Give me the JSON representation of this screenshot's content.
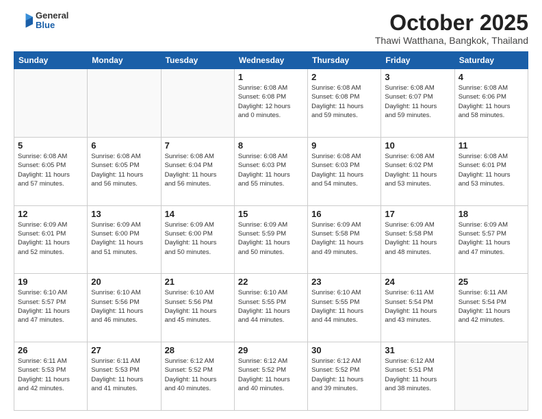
{
  "header": {
    "logo": {
      "general": "General",
      "blue": "Blue"
    },
    "title": "October 2025",
    "location": "Thawi Watthana, Bangkok, Thailand"
  },
  "weekdays": [
    "Sunday",
    "Monday",
    "Tuesday",
    "Wednesday",
    "Thursday",
    "Friday",
    "Saturday"
  ],
  "weeks": [
    [
      {
        "day": "",
        "info": ""
      },
      {
        "day": "",
        "info": ""
      },
      {
        "day": "",
        "info": ""
      },
      {
        "day": "1",
        "info": "Sunrise: 6:08 AM\nSunset: 6:08 PM\nDaylight: 12 hours\nand 0 minutes."
      },
      {
        "day": "2",
        "info": "Sunrise: 6:08 AM\nSunset: 6:08 PM\nDaylight: 11 hours\nand 59 minutes."
      },
      {
        "day": "3",
        "info": "Sunrise: 6:08 AM\nSunset: 6:07 PM\nDaylight: 11 hours\nand 59 minutes."
      },
      {
        "day": "4",
        "info": "Sunrise: 6:08 AM\nSunset: 6:06 PM\nDaylight: 11 hours\nand 58 minutes."
      }
    ],
    [
      {
        "day": "5",
        "info": "Sunrise: 6:08 AM\nSunset: 6:05 PM\nDaylight: 11 hours\nand 57 minutes."
      },
      {
        "day": "6",
        "info": "Sunrise: 6:08 AM\nSunset: 6:05 PM\nDaylight: 11 hours\nand 56 minutes."
      },
      {
        "day": "7",
        "info": "Sunrise: 6:08 AM\nSunset: 6:04 PM\nDaylight: 11 hours\nand 56 minutes."
      },
      {
        "day": "8",
        "info": "Sunrise: 6:08 AM\nSunset: 6:03 PM\nDaylight: 11 hours\nand 55 minutes."
      },
      {
        "day": "9",
        "info": "Sunrise: 6:08 AM\nSunset: 6:03 PM\nDaylight: 11 hours\nand 54 minutes."
      },
      {
        "day": "10",
        "info": "Sunrise: 6:08 AM\nSunset: 6:02 PM\nDaylight: 11 hours\nand 53 minutes."
      },
      {
        "day": "11",
        "info": "Sunrise: 6:08 AM\nSunset: 6:01 PM\nDaylight: 11 hours\nand 53 minutes."
      }
    ],
    [
      {
        "day": "12",
        "info": "Sunrise: 6:09 AM\nSunset: 6:01 PM\nDaylight: 11 hours\nand 52 minutes."
      },
      {
        "day": "13",
        "info": "Sunrise: 6:09 AM\nSunset: 6:00 PM\nDaylight: 11 hours\nand 51 minutes."
      },
      {
        "day": "14",
        "info": "Sunrise: 6:09 AM\nSunset: 6:00 PM\nDaylight: 11 hours\nand 50 minutes."
      },
      {
        "day": "15",
        "info": "Sunrise: 6:09 AM\nSunset: 5:59 PM\nDaylight: 11 hours\nand 50 minutes."
      },
      {
        "day": "16",
        "info": "Sunrise: 6:09 AM\nSunset: 5:58 PM\nDaylight: 11 hours\nand 49 minutes."
      },
      {
        "day": "17",
        "info": "Sunrise: 6:09 AM\nSunset: 5:58 PM\nDaylight: 11 hours\nand 48 minutes."
      },
      {
        "day": "18",
        "info": "Sunrise: 6:09 AM\nSunset: 5:57 PM\nDaylight: 11 hours\nand 47 minutes."
      }
    ],
    [
      {
        "day": "19",
        "info": "Sunrise: 6:10 AM\nSunset: 5:57 PM\nDaylight: 11 hours\nand 47 minutes."
      },
      {
        "day": "20",
        "info": "Sunrise: 6:10 AM\nSunset: 5:56 PM\nDaylight: 11 hours\nand 46 minutes."
      },
      {
        "day": "21",
        "info": "Sunrise: 6:10 AM\nSunset: 5:56 PM\nDaylight: 11 hours\nand 45 minutes."
      },
      {
        "day": "22",
        "info": "Sunrise: 6:10 AM\nSunset: 5:55 PM\nDaylight: 11 hours\nand 44 minutes."
      },
      {
        "day": "23",
        "info": "Sunrise: 6:10 AM\nSunset: 5:55 PM\nDaylight: 11 hours\nand 44 minutes."
      },
      {
        "day": "24",
        "info": "Sunrise: 6:11 AM\nSunset: 5:54 PM\nDaylight: 11 hours\nand 43 minutes."
      },
      {
        "day": "25",
        "info": "Sunrise: 6:11 AM\nSunset: 5:54 PM\nDaylight: 11 hours\nand 42 minutes."
      }
    ],
    [
      {
        "day": "26",
        "info": "Sunrise: 6:11 AM\nSunset: 5:53 PM\nDaylight: 11 hours\nand 42 minutes."
      },
      {
        "day": "27",
        "info": "Sunrise: 6:11 AM\nSunset: 5:53 PM\nDaylight: 11 hours\nand 41 minutes."
      },
      {
        "day": "28",
        "info": "Sunrise: 6:12 AM\nSunset: 5:52 PM\nDaylight: 11 hours\nand 40 minutes."
      },
      {
        "day": "29",
        "info": "Sunrise: 6:12 AM\nSunset: 5:52 PM\nDaylight: 11 hours\nand 40 minutes."
      },
      {
        "day": "30",
        "info": "Sunrise: 6:12 AM\nSunset: 5:52 PM\nDaylight: 11 hours\nand 39 minutes."
      },
      {
        "day": "31",
        "info": "Sunrise: 6:12 AM\nSunset: 5:51 PM\nDaylight: 11 hours\nand 38 minutes."
      },
      {
        "day": "",
        "info": ""
      }
    ]
  ]
}
